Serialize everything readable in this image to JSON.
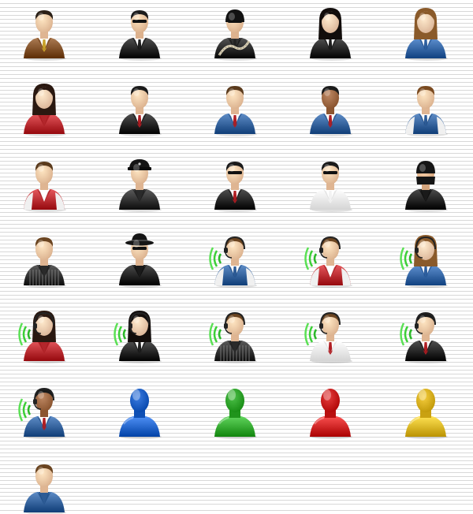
{
  "icons": [
    {
      "name": "businessman-brown-suit-icon",
      "skin": "#f3c9a6",
      "hair": "#2b2017",
      "hair_style": "short",
      "torso": "#7a4a22",
      "shirt": "#ffffff",
      "tie": "#c9a22a",
      "headset": false,
      "glasses": false
    },
    {
      "name": "bodyguard-sunglasses-icon",
      "skin": "#f1c6a2",
      "hair": "#1c1c1c",
      "hair_style": "short",
      "torso": "#1e1e1e",
      "shirt": "#ffffff",
      "tie": "#1e1e1e",
      "headset": false,
      "glasses": true
    },
    {
      "name": "burglar-mask-rope-icon",
      "skin": "#f1c6a2",
      "hair": "#121212",
      "hair_style": "cap",
      "torso": "#222222",
      "shirt": "#333333",
      "tie": "#222222",
      "headset": false,
      "glasses": true,
      "rope": true
    },
    {
      "name": "businesswoman-black-suit-icon",
      "skin": "#f3cdb0",
      "hair": "#120d0b",
      "hair_style": "long",
      "torso": "#1f1f1f",
      "shirt": "#ffffff",
      "tie": "#1f1f1f",
      "headset": false,
      "glasses": false
    },
    {
      "name": "businesswoman-blue-suit-icon",
      "skin": "#f3cdb0",
      "hair": "#8a5a2a",
      "hair_style": "long",
      "torso": "#2e5f9e",
      "shirt": "#ffffff",
      "tie": "#2e5f9e",
      "headset": false,
      "glasses": false
    },
    {
      "name": "woman-red-blouse-icon",
      "skin": "#f3cdb0",
      "hair": "#2a1810",
      "hair_style": "long",
      "torso": "#b3262b",
      "shirt": "#b3262b",
      "tie": "#b3262b",
      "headset": false,
      "glasses": false
    },
    {
      "name": "businessman-black-suit-icon",
      "skin": "#f3c9a6",
      "hair": "#1a1a1a",
      "hair_style": "short",
      "torso": "#1e1e1e",
      "shirt": "#ffffff",
      "tie": "#b01e23",
      "headset": false,
      "glasses": false
    },
    {
      "name": "businessman-blue-suit-icon",
      "skin": "#f3c9a6",
      "hair": "#5a3a1c",
      "hair_style": "short",
      "torso": "#2d5b95",
      "shirt": "#ffffff",
      "tie": "#b01e23",
      "headset": false,
      "glasses": false
    },
    {
      "name": "dark-skin-businessman-blue-suit-icon",
      "skin": "#a06a45",
      "hair": "#1a1a1a",
      "hair_style": "short",
      "torso": "#2d5b95",
      "shirt": "#ffffff",
      "tie": "#b01e23",
      "headset": false,
      "glasses": false
    },
    {
      "name": "man-blue-tshirt-icon",
      "skin": "#f3c9a6",
      "hair": "#7a4a20",
      "hair_style": "short",
      "torso": "#2d5b95",
      "shirt": "#ffffff",
      "tie": "#2d5b95",
      "headset": false,
      "glasses": false,
      "sleeves": true
    },
    {
      "name": "man-red-vest-icon",
      "skin": "#f3c9a6",
      "hair": "#5a3a1c",
      "hair_style": "short",
      "torso": "#b3262b",
      "shirt": "#ffffff",
      "tie": "#ffffff",
      "headset": false,
      "glasses": false,
      "sleeves": true
    },
    {
      "name": "police-officer-icon",
      "skin": "#f3c9a6",
      "hair": "#141414",
      "hair_style": "police",
      "torso": "#2a2a2a",
      "shirt": "#2a2a2a",
      "tie": "#2a2a2a",
      "headset": false,
      "glasses": false
    },
    {
      "name": "agent-sunglasses-icon",
      "skin": "#f3c9a6",
      "hair": "#1a1a1a",
      "hair_style": "short",
      "torso": "#1e1e1e",
      "shirt": "#ffffff",
      "tie": "#b01e23",
      "headset": false,
      "glasses": true
    },
    {
      "name": "man-glasses-white-shirt-icon",
      "skin": "#f3c9a6",
      "hair": "#1a1a1a",
      "hair_style": "short",
      "torso": "#f2f2f2",
      "shirt": "#ffffff",
      "tie": "#f2f2f2",
      "headset": false,
      "glasses": true
    },
    {
      "name": "ninja-icon",
      "skin": "#e8b890",
      "hair": "#151515",
      "hair_style": "ninja",
      "torso": "#1a1a1a",
      "shirt": "#1a1a1a",
      "tie": "#1a1a1a",
      "headset": false,
      "glasses": false
    },
    {
      "name": "man-striped-sweater-icon",
      "skin": "#f3c9a6",
      "hair": "#6a4420",
      "hair_style": "short",
      "torso": "#2a2a2a",
      "shirt": "#2a2a2a",
      "tie": "#2a2a2a",
      "headset": false,
      "glasses": false,
      "stripes": true
    },
    {
      "name": "spy-hat-icon",
      "skin": "#f3c9a6",
      "hair": "#151515",
      "hair_style": "hat",
      "torso": "#1a1a1a",
      "shirt": "#1a1a1a",
      "tie": "#1a1a1a",
      "headset": false,
      "glasses": true
    },
    {
      "name": "operator-blue-shirt-icon",
      "skin": "#f3c9a6",
      "hair": "#6a4420",
      "hair_style": "short",
      "torso": "#2d5b95",
      "shirt": "#ffffff",
      "tie": "#2d5b95",
      "headset": true,
      "glasses": false,
      "sleeves": true
    },
    {
      "name": "operator-red-vest-icon",
      "skin": "#f3c9a6",
      "hair": "#6a4420",
      "hair_style": "short",
      "torso": "#b3262b",
      "shirt": "#ffffff",
      "tie": "#ffffff",
      "headset": true,
      "glasses": false,
      "sleeves": true
    },
    {
      "name": "operator-woman-blue-icon",
      "skin": "#f3cdb0",
      "hair": "#8a5a2a",
      "hair_style": "long",
      "torso": "#2e5f9e",
      "shirt": "#ffffff",
      "tie": "#2e5f9e",
      "headset": true,
      "glasses": false
    },
    {
      "name": "operator-woman-red-icon",
      "skin": "#f3cdb0",
      "hair": "#2a1810",
      "hair_style": "long",
      "torso": "#b3262b",
      "shirt": "#b3262b",
      "tie": "#b3262b",
      "headset": true,
      "glasses": false
    },
    {
      "name": "operator-woman-black-icon",
      "skin": "#f3cdb0",
      "hair": "#120d0b",
      "hair_style": "long",
      "torso": "#1f1f1f",
      "shirt": "#ffffff",
      "tie": "#1f1f1f",
      "headset": true,
      "glasses": false
    },
    {
      "name": "operator-striped-sweater-icon",
      "skin": "#f3c9a6",
      "hair": "#6a4420",
      "hair_style": "short",
      "torso": "#2a2a2a",
      "shirt": "#2a2a2a",
      "tie": "#2a2a2a",
      "headset": true,
      "glasses": false,
      "stripes": true
    },
    {
      "name": "operator-white-shirt-icon",
      "skin": "#f3c9a6",
      "hair": "#6a4420",
      "hair_style": "short",
      "torso": "#f2f2f2",
      "shirt": "#ffffff",
      "tie": "#b01e23",
      "headset": true,
      "glasses": false
    },
    {
      "name": "operator-black-suit-icon",
      "skin": "#f3c9a6",
      "hair": "#1a1a1a",
      "hair_style": "short",
      "torso": "#1e1e1e",
      "shirt": "#ffffff",
      "tie": "#b01e23",
      "headset": true,
      "glasses": false
    },
    {
      "name": "operator-dark-skin-blue-suit-icon",
      "skin": "#a06a45",
      "hair": "#1a1a1a",
      "hair_style": "short",
      "torso": "#2d5b95",
      "shirt": "#ffffff",
      "tie": "#b01e23",
      "headset": true,
      "glasses": false
    },
    {
      "name": "user-silhouette-blue-icon",
      "silhouette": true,
      "color": "#1e5fc4"
    },
    {
      "name": "user-silhouette-green-icon",
      "silhouette": true,
      "color": "#2fa32b"
    },
    {
      "name": "user-silhouette-red-icon",
      "silhouette": true,
      "color": "#c81e1e"
    },
    {
      "name": "user-silhouette-yellow-icon",
      "silhouette": true,
      "color": "#d8b020"
    },
    {
      "name": "man-blue-shirt-icon",
      "skin": "#f3c9a6",
      "hair": "#6a4420",
      "hair_style": "short",
      "torso": "#2d5b95",
      "shirt": "#2d5b95",
      "tie": "#2d5b95",
      "headset": false,
      "glasses": false
    }
  ]
}
